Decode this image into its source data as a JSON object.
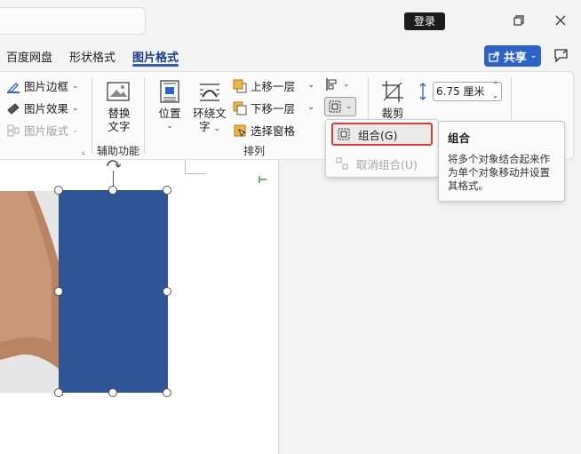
{
  "titlebar": {
    "login_label": "登录"
  },
  "tabs": [
    {
      "label": "百度网盘"
    },
    {
      "label": "形状格式"
    },
    {
      "label": "图片格式"
    }
  ],
  "share": {
    "label": "共享"
  },
  "ribbon": {
    "picture_border": "图片边框",
    "picture_effects": "图片效果",
    "picture_layout": "图片版式",
    "alt_text_line1": "替换",
    "alt_text_line2": "文字",
    "accessibility_label": "辅助功能",
    "position": "位置",
    "wrap_text_line1": "环绕文",
    "wrap_text_line2": "字",
    "bring_forward": "上移一层",
    "send_backward": "下移一层",
    "selection_pane": "选择窗格",
    "arrange_label": "排列",
    "crop": "裁剪",
    "height_value": "6.75 厘米"
  },
  "dropdown": {
    "group": "组合(G)",
    "ungroup": "取消组合(U)"
  },
  "tooltip": {
    "title": "组合",
    "body": "将多个对象结合起来作为单个对象移动并设置其格式。"
  },
  "colors": {
    "accent": "#2b63c9",
    "shape_fill": "#2f5597",
    "highlight_border": "#e03a3a"
  }
}
